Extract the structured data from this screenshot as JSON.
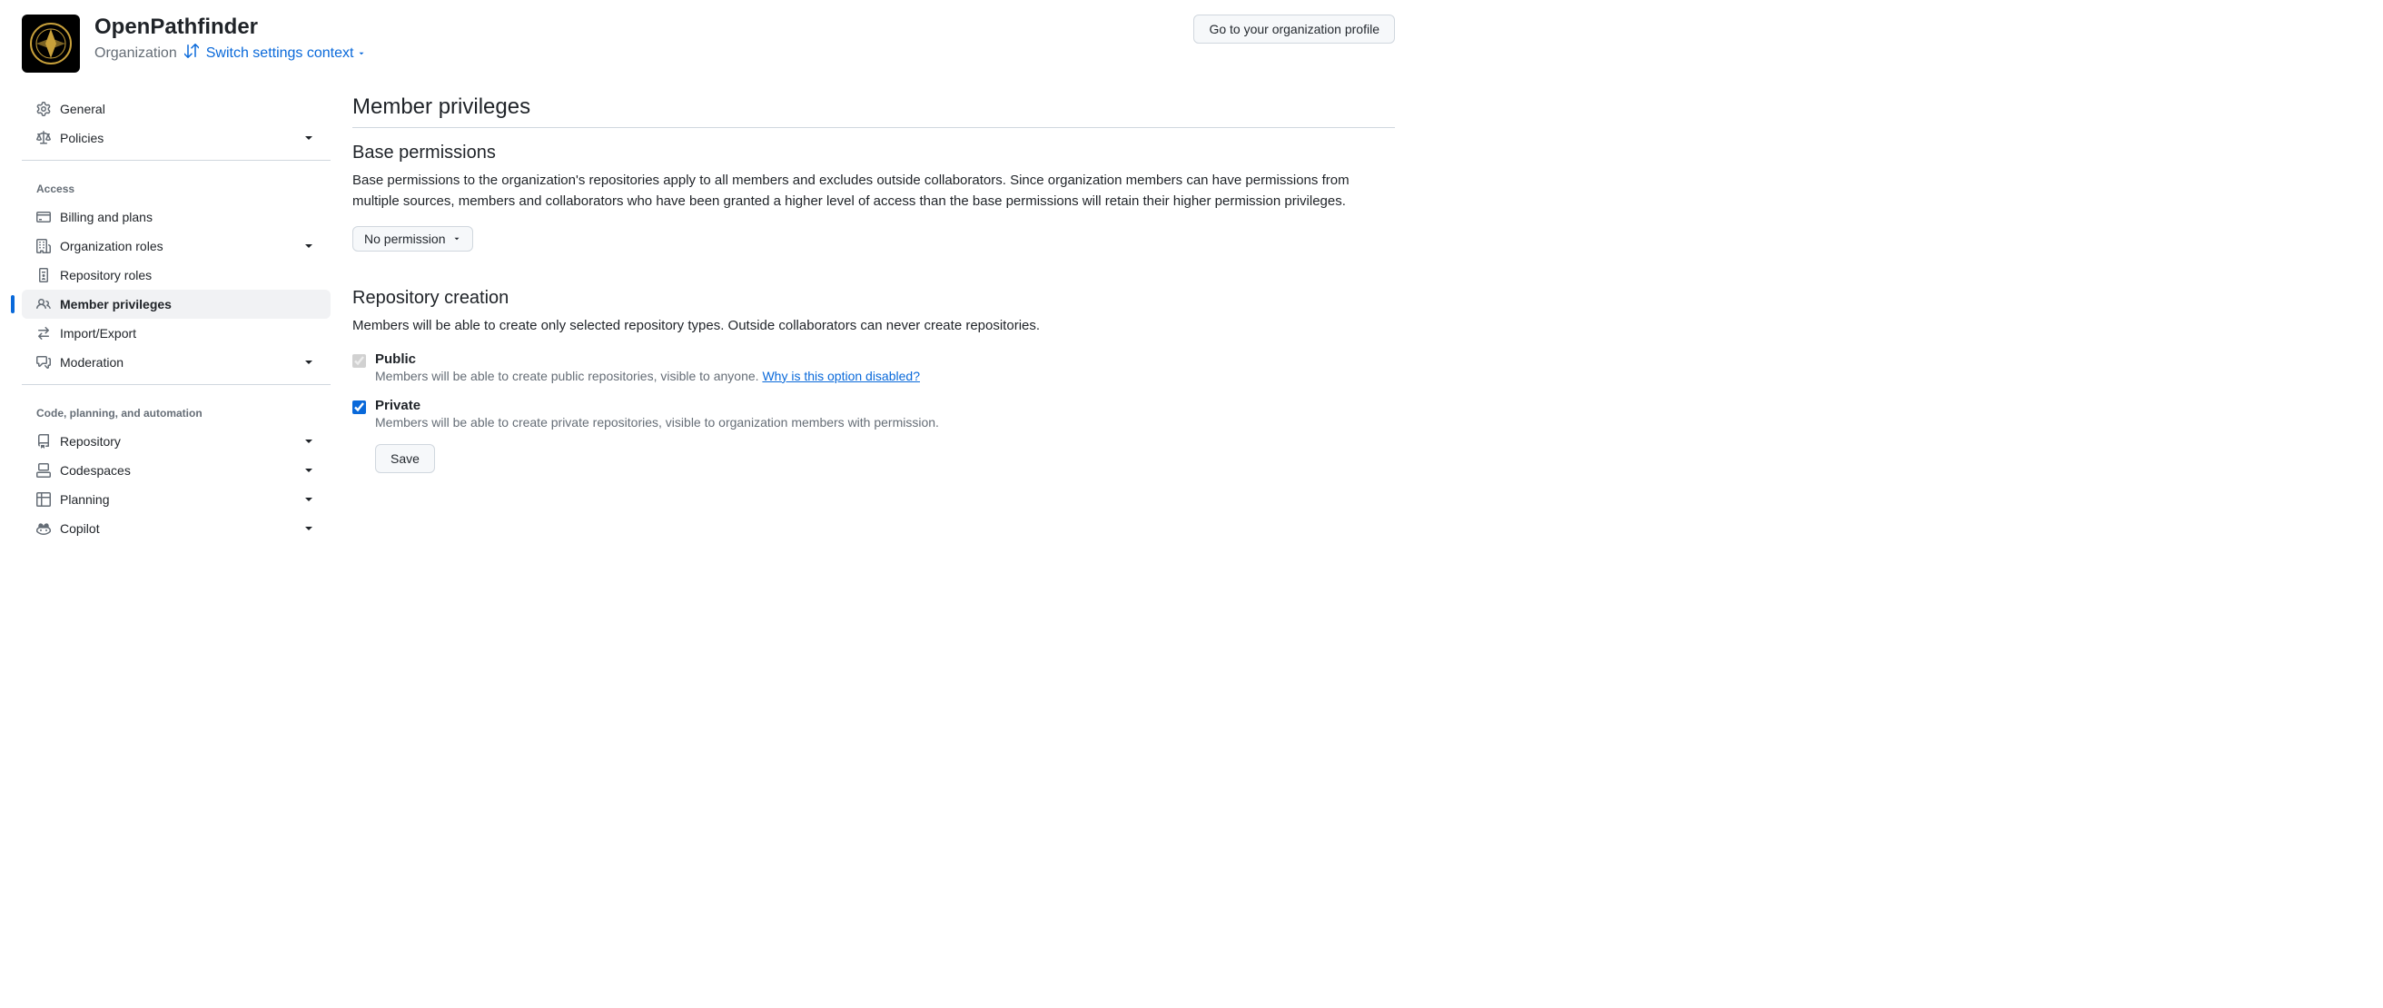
{
  "header": {
    "org_name": "OpenPathfinder",
    "org_label": "Organization",
    "switch_context": "Switch settings context",
    "profile_button": "Go to your organization profile"
  },
  "sidebar": {
    "items": [
      {
        "label": "General",
        "icon": "gear"
      },
      {
        "label": "Policies",
        "icon": "law",
        "expandable": true
      }
    ],
    "access_heading": "Access",
    "access_items": [
      {
        "label": "Billing and plans",
        "icon": "credit-card"
      },
      {
        "label": "Organization roles",
        "icon": "organization",
        "expandable": true
      },
      {
        "label": "Repository roles",
        "icon": "id-badge"
      },
      {
        "label": "Member privileges",
        "icon": "people",
        "active": true
      },
      {
        "label": "Import/Export",
        "icon": "arrow-switch"
      },
      {
        "label": "Moderation",
        "icon": "comment-discussion",
        "expandable": true
      }
    ],
    "code_heading": "Code, planning, and automation",
    "code_items": [
      {
        "label": "Repository",
        "icon": "repo",
        "expandable": true
      },
      {
        "label": "Codespaces",
        "icon": "codespaces",
        "expandable": true
      },
      {
        "label": "Planning",
        "icon": "table",
        "expandable": true
      },
      {
        "label": "Copilot",
        "icon": "copilot",
        "expandable": true
      }
    ]
  },
  "main": {
    "page_title": "Member privileges",
    "base_permissions": {
      "title": "Base permissions",
      "description": "Base permissions to the organization's repositories apply to all members and excludes outside collaborators. Since organization members can have permissions from multiple sources, members and collaborators who have been granted a higher level of access than the base permissions will retain their higher permission privileges.",
      "dropdown_value": "No permission"
    },
    "repo_creation": {
      "title": "Repository creation",
      "description": "Members will be able to create only selected repository types. Outside collaborators can never create repositories.",
      "public": {
        "label": "Public",
        "description": "Members will be able to create public repositories, visible to anyone. ",
        "link": "Why is this option disabled?",
        "checked": true,
        "disabled": true
      },
      "private": {
        "label": "Private",
        "description": "Members will be able to create private repositories, visible to organization members with permission.",
        "checked": true,
        "disabled": false
      },
      "save_button": "Save"
    }
  }
}
